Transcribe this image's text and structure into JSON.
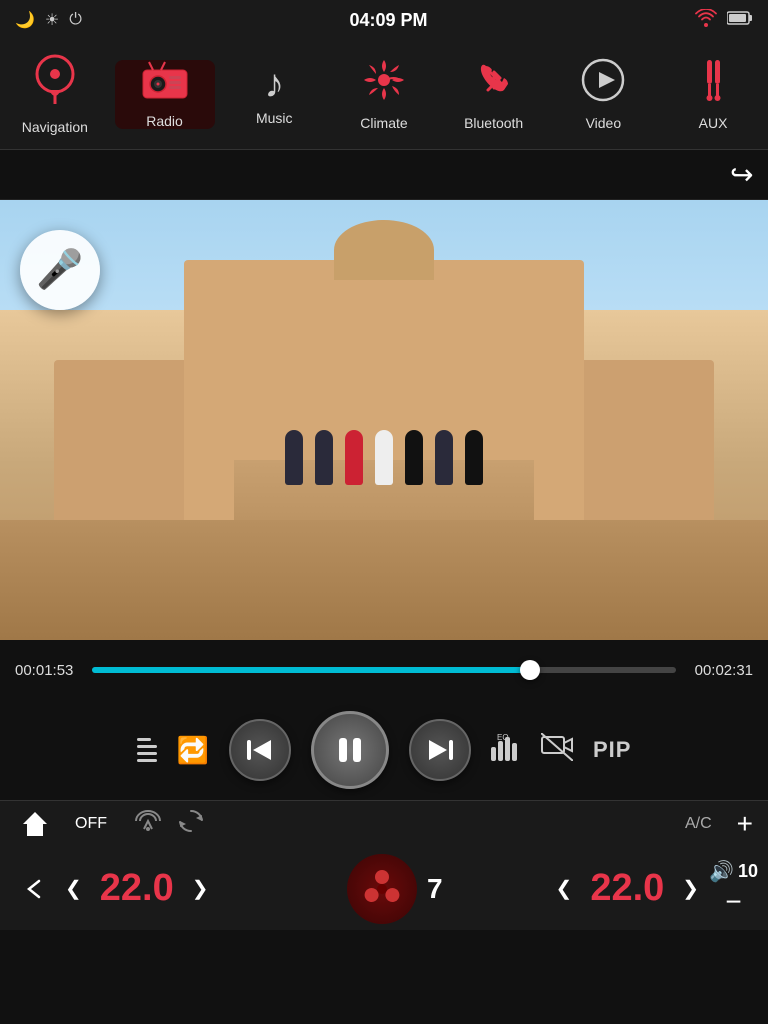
{
  "statusBar": {
    "time": "04:09 PM",
    "moonIcon": "🌙",
    "sunIcon": "☀",
    "powerIcon": "⏻",
    "wifiIcon": "wifi",
    "batteryIcon": "battery"
  },
  "navBar": {
    "items": [
      {
        "id": "navigation",
        "label": "Navigation",
        "icon": "📍",
        "active": false
      },
      {
        "id": "radio",
        "label": "Radio",
        "icon": "📻",
        "active": true
      },
      {
        "id": "music",
        "label": "Music",
        "icon": "🎵",
        "active": false
      },
      {
        "id": "climate",
        "label": "Climate",
        "icon": "❄",
        "active": false
      },
      {
        "id": "bluetooth",
        "label": "Bluetooth",
        "icon": "📞",
        "active": false
      },
      {
        "id": "video",
        "label": "Video",
        "icon": "▶",
        "active": false
      },
      {
        "id": "aux",
        "label": "AUX",
        "icon": "🔌",
        "active": false
      }
    ]
  },
  "backBar": {
    "backIcon": "↩"
  },
  "video": {
    "currentTime": "00:01:53",
    "totalTime": "00:02:31",
    "progressPercent": 75
  },
  "controls": {
    "listLabel": "☰",
    "repeatLabel": "🔁",
    "prevLabel": "⏮",
    "playPauseLabel": "⏸",
    "nextLabel": "⏭",
    "eqLabel": "EQ",
    "noVideoLabel": "⛔",
    "pipLabel": "PIP"
  },
  "climate": {
    "homeIcon": "⬆",
    "backIcon": "↩",
    "offLabel": "OFF",
    "fanSmallIcon": "🍃",
    "acLabel": "A/C",
    "plusLabel": "+",
    "minusLabel": "−",
    "tempLeft": "22.0",
    "tempRight": "22.0",
    "fanSpeed": "7",
    "volIcon": "🔊",
    "volNumber": "10"
  }
}
